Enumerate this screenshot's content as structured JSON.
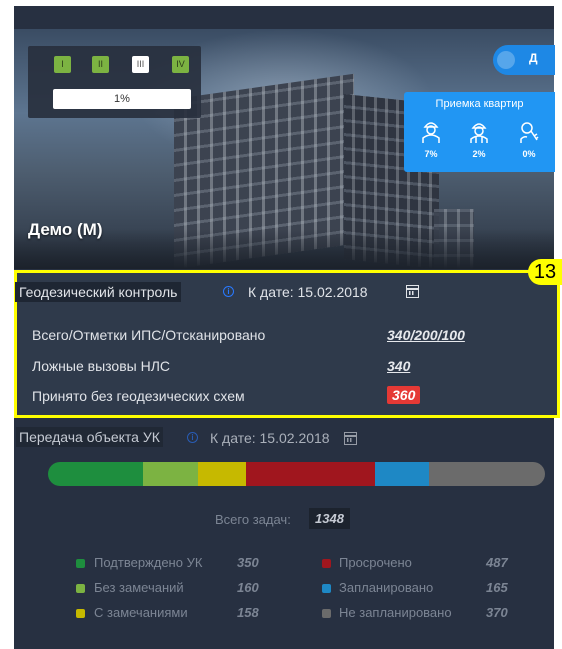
{
  "project": {
    "name": "Демо (М)",
    "stages": [
      "I",
      "II",
      "III",
      "IV"
    ],
    "progress": "1%",
    "toggle_label": "Д"
  },
  "acceptance": {
    "title": "Приемка квартир",
    "items": [
      {
        "icon": "inspector-icon",
        "value": "7%"
      },
      {
        "icon": "worker-icon",
        "value": "2%"
      },
      {
        "icon": "key-icon",
        "value": "0%"
      }
    ]
  },
  "geo_control": {
    "title": "Геодезический контроль",
    "date_label": "К дате:",
    "date": "15.02.2018",
    "badge": "13",
    "rows": [
      {
        "label": "Всего/Отметки ИПС/Отсканировано",
        "value": "340/200/100"
      },
      {
        "label": "Ложные вызовы НЛС",
        "value": "340"
      },
      {
        "label": "Принято без геодезических схем",
        "value": "360"
      }
    ],
    "alert_color": "#e53935"
  },
  "transfer": {
    "title": "Передача объекта УК",
    "date_label": "К дате:",
    "date": "15.02.2018",
    "total_label": "Всего задач:",
    "total": "1348",
    "legend": [
      {
        "label": "Подтверждено УК",
        "value": "350",
        "color": "#1e8e3e"
      },
      {
        "label": "Без замечаний",
        "value": "160",
        "color": "#7cb342"
      },
      {
        "label": "С замечаниями",
        "value": "158",
        "color": "#c6b900"
      },
      {
        "label": "Просрочено",
        "value": "487",
        "color": "#a0161e"
      },
      {
        "label": "Запланировано",
        "value": "165",
        "color": "#1e88c5"
      },
      {
        "label": "Не запланировано",
        "value": "370",
        "color": "#6b6b6b"
      }
    ]
  }
}
